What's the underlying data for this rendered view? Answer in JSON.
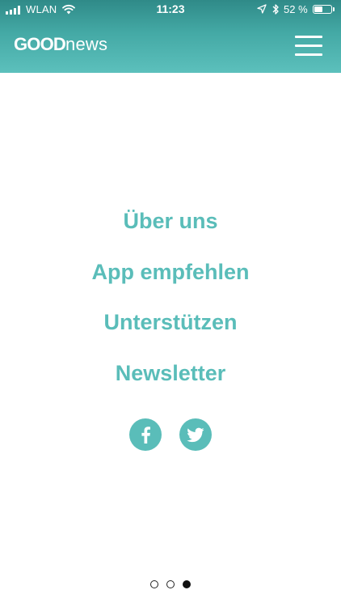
{
  "status_bar": {
    "carrier": "WLAN",
    "time": "11:23",
    "battery_percent_text": "52 %",
    "battery_level": 0.52,
    "icons": [
      "signal-bars-icon",
      "wifi-icon",
      "location-arrow-icon",
      "bluetooth-icon",
      "battery-icon"
    ]
  },
  "header": {
    "logo_strong": "GOOD",
    "logo_light": "news",
    "menu_icon": "hamburger-menu-icon"
  },
  "menu": {
    "items": [
      {
        "label": "Über uns"
      },
      {
        "label": "App empfehlen"
      },
      {
        "label": "Unterstützen"
      },
      {
        "label": "Newsletter"
      }
    ]
  },
  "social": {
    "icons": [
      "facebook-icon",
      "twitter-icon"
    ]
  },
  "pager": {
    "total": 3,
    "current": 3
  },
  "colors": {
    "accent": "#5abdb9",
    "header_top": "#2f8a88",
    "header_bottom": "#5cc0bc",
    "background": "#ffffff"
  }
}
